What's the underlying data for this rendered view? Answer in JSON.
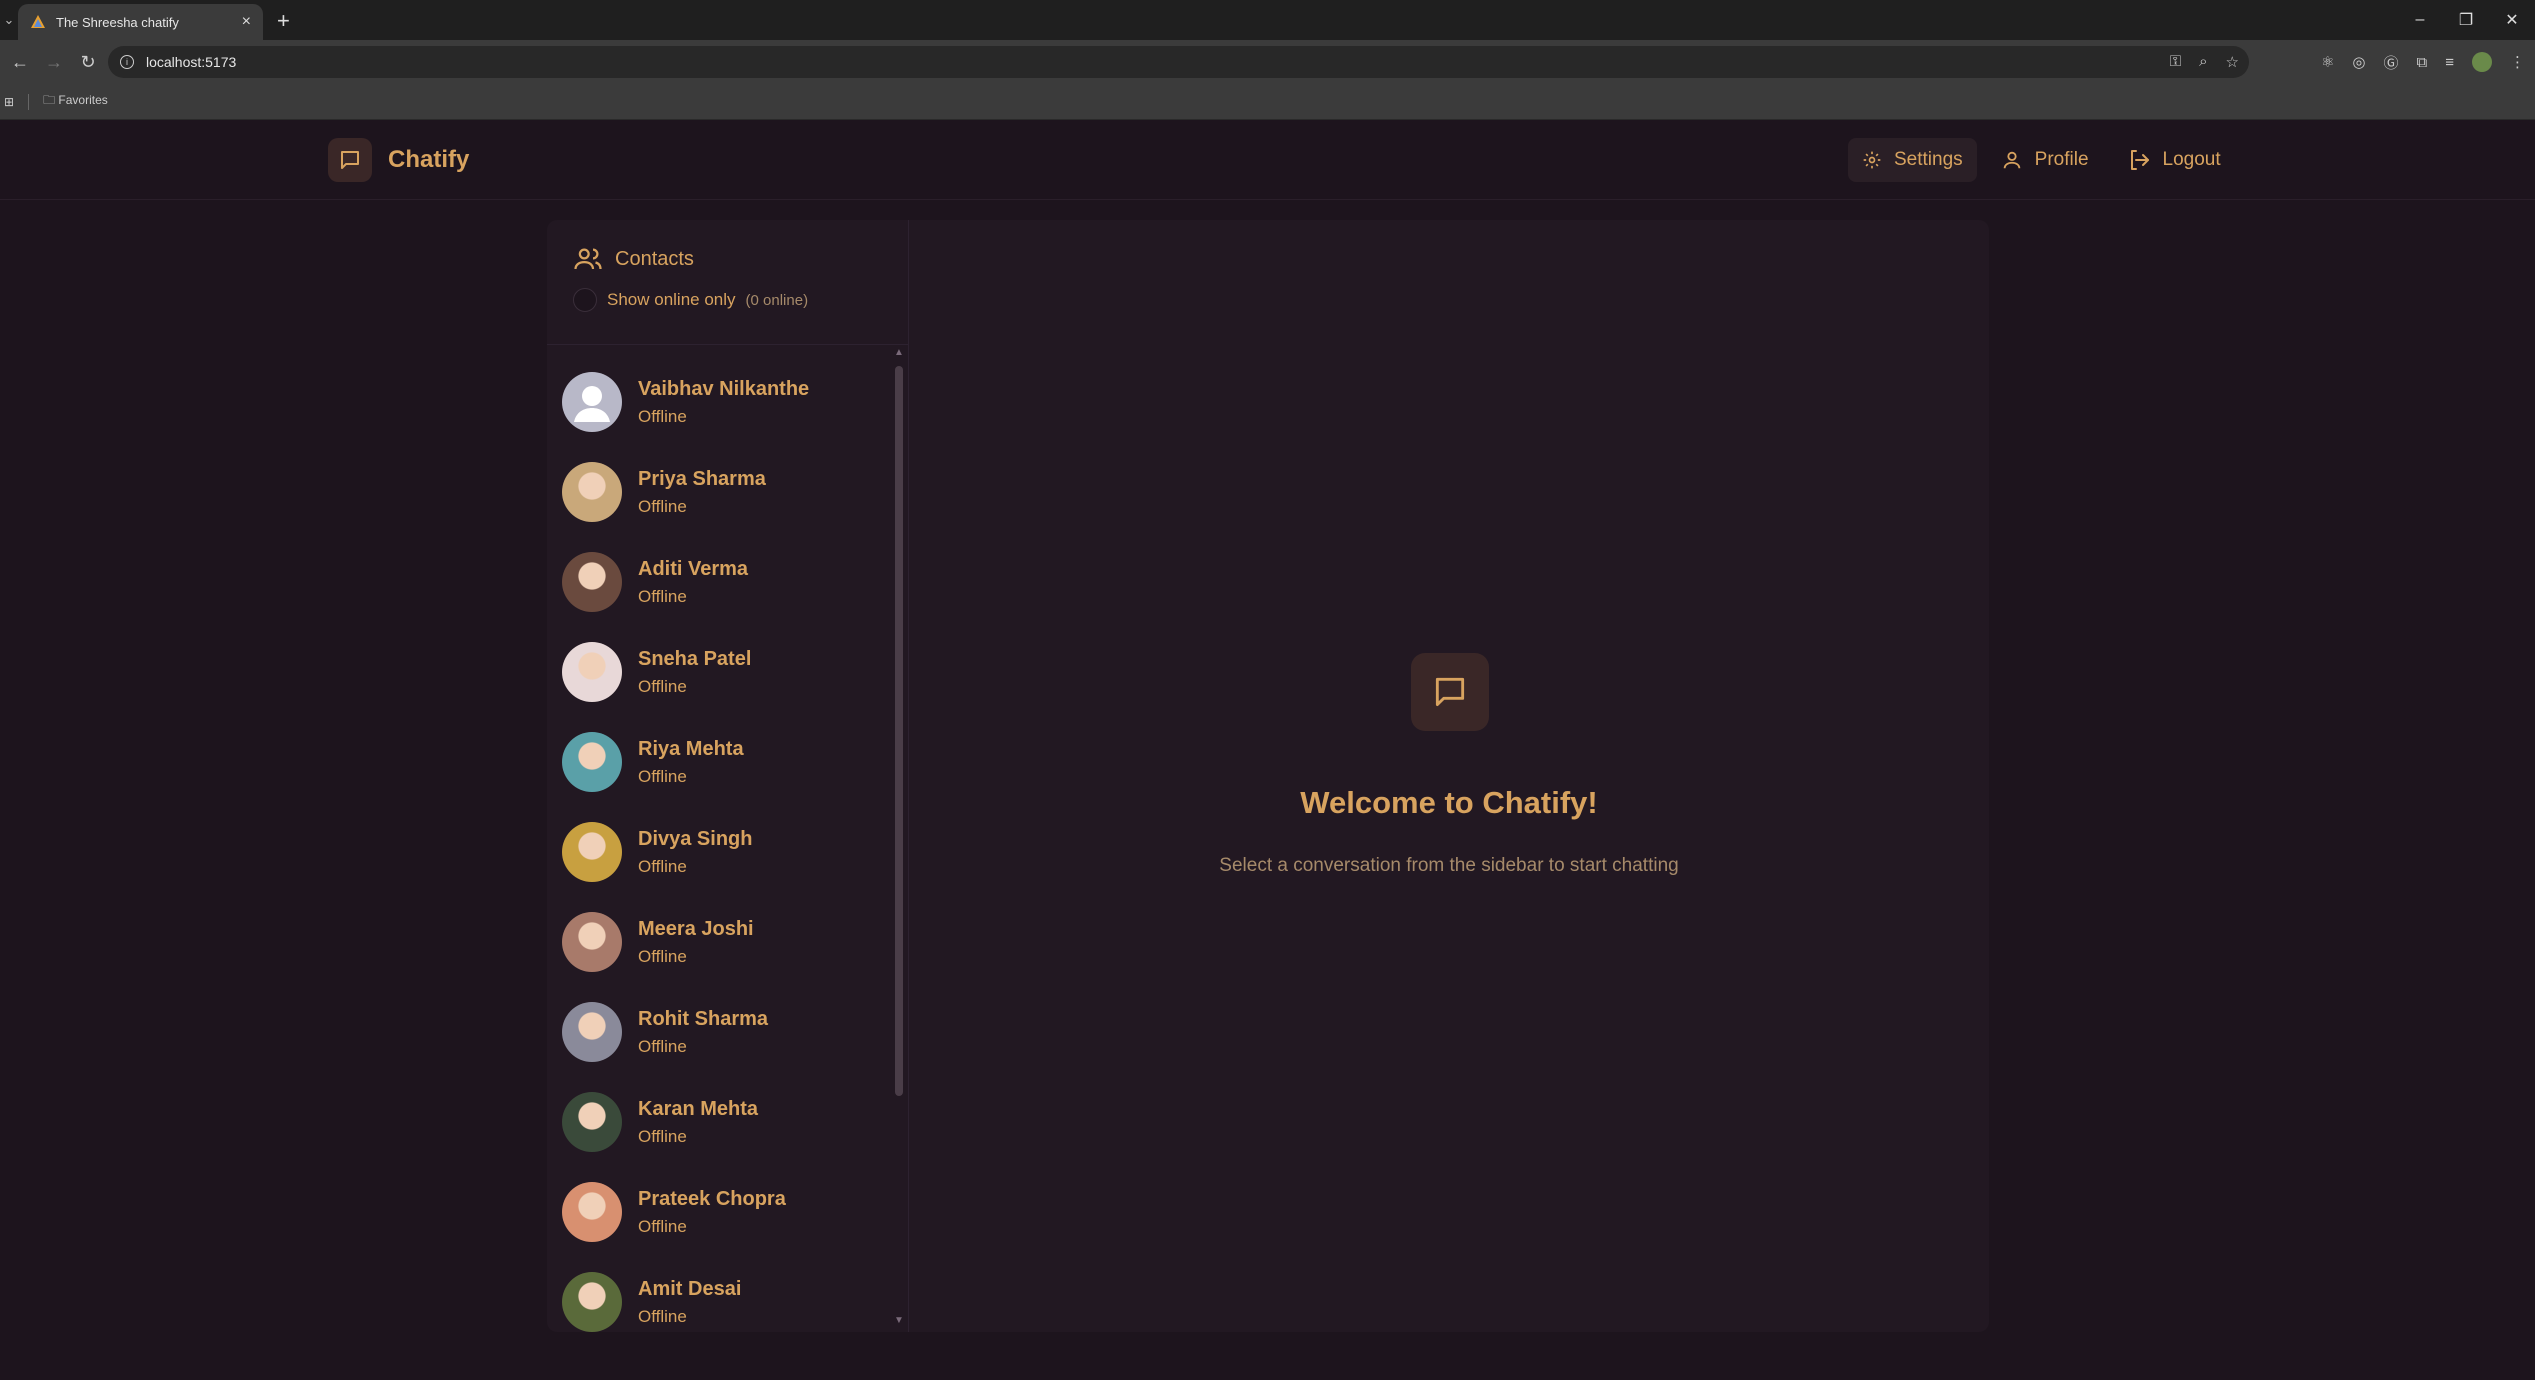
{
  "browser": {
    "tab_title": "The Shreesha chatify",
    "url": "localhost:5173",
    "bookmark_folder": "Favorites"
  },
  "app": {
    "brand": "Chatify",
    "nav": {
      "settings": "Settings",
      "profile": "Profile",
      "logout": "Logout"
    }
  },
  "sidebar": {
    "title": "Contacts",
    "filter_label": "Show online only",
    "online_count": "(0 online)",
    "contacts": [
      {
        "name": "Vaibhav Nilkanthe",
        "status": "Offline",
        "avatar": "default-avatar",
        "color": "#b8b8c8"
      },
      {
        "name": "Priya Sharma",
        "status": "Offline",
        "avatar": "photo",
        "color": "#c9a87a"
      },
      {
        "name": "Aditi Verma",
        "status": "Offline",
        "avatar": "photo",
        "color": "#6a4a3e"
      },
      {
        "name": "Sneha Patel",
        "status": "Offline",
        "avatar": "photo",
        "color": "#e8d8d8"
      },
      {
        "name": "Riya Mehta",
        "status": "Offline",
        "avatar": "photo",
        "color": "#5aa0a8"
      },
      {
        "name": "Divya Singh",
        "status": "Offline",
        "avatar": "photo",
        "color": "#c8a040"
      },
      {
        "name": "Meera Joshi",
        "status": "Offline",
        "avatar": "photo",
        "color": "#a87a6a"
      },
      {
        "name": "Rohit Sharma",
        "status": "Offline",
        "avatar": "photo",
        "color": "#8a8a9a"
      },
      {
        "name": "Karan Mehta",
        "status": "Offline",
        "avatar": "photo",
        "color": "#3a4a3a"
      },
      {
        "name": "Prateek Chopra",
        "status": "Offline",
        "avatar": "photo",
        "color": "#d89070"
      },
      {
        "name": "Amit Desai",
        "status": "Offline",
        "avatar": "photo",
        "color": "#5a6a3a"
      }
    ]
  },
  "welcome": {
    "title": "Welcome to Chatify!",
    "subtitle": "Select a conversation from the sidebar to start chatting"
  },
  "colors": {
    "accent": "#d8a35f",
    "background": "#1d141d",
    "panel": "#221822"
  }
}
